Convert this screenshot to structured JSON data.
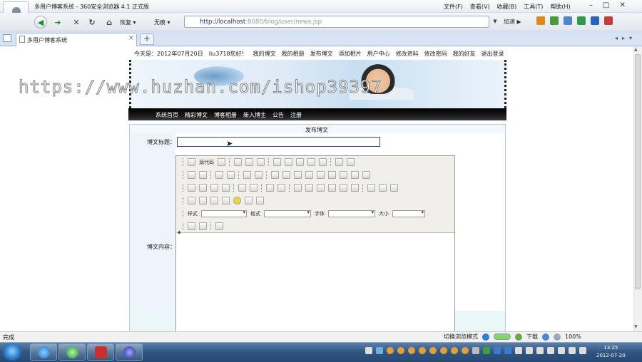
{
  "window": {
    "title": "多用户博客系统 - 360安全浏览器 4.1 正式版",
    "menu": [
      "文件(F)",
      "查看(V)",
      "收藏(B)",
      "工具(T)",
      "帮助(H)"
    ],
    "controls": [
      "–",
      "□",
      "✕"
    ]
  },
  "toolbar": {
    "back": "◀",
    "forward": "➜",
    "stop": "✕",
    "refresh": "↻",
    "home": "⌂",
    "restore_label": "恢复 ▾",
    "no_trace_label": "无痕 ▾",
    "address_host": "http://localhost",
    "address_rest": ":8080/blog/user/news.jsp",
    "go_label": "加速",
    "play": "▶"
  },
  "tabs": {
    "active_label": "多用户博客系统",
    "close": "×",
    "new_tab": "+",
    "right_icons": [
      "◂",
      "▸",
      "▾"
    ]
  },
  "page": {
    "top_nav": [
      "今天是：2012年07月20日",
      "liu3718您好！",
      "我的博文",
      "我的相册",
      "发布博文",
      "添加相片",
      "用户中心",
      "修改资料",
      "修改密码",
      "我的好友",
      "退出登录"
    ],
    "site_nav": [
      "系统首页",
      "精彩博文",
      "博客相册",
      "新入博主",
      "公告",
      "注册"
    ],
    "form_title": "发布博文",
    "title_label": "博文标题：",
    "title_value": "",
    "content_label": "博文内容：",
    "editor": {
      "source_button": "源代码",
      "style_label": "样式",
      "format_label": "格式",
      "font_label": "字体",
      "size_label": "大小",
      "collapse_mark": "▲"
    }
  },
  "watermark": "https://www.huzhan.com/ishop39397",
  "status": {
    "left": "完成",
    "switch_mode": "切换浏览模式",
    "download": "下载",
    "zoom": "100%"
  },
  "taskbar": {
    "clock_time": "13:25",
    "clock_date": "2012-07-20"
  },
  "colors": {
    "banner_bar": "#000000",
    "title_input_border": "#334a86",
    "taskbar": "#2f5580"
  }
}
